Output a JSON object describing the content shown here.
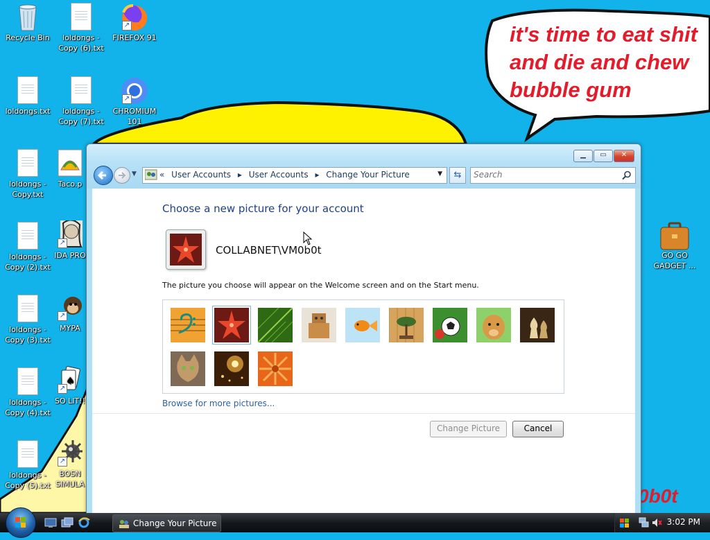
{
  "desktop": {
    "icons": [
      {
        "label": "Recycle Bin",
        "kind": "recycle-bin"
      },
      {
        "label": "loldongs - Copy (6).txt",
        "kind": "text-file"
      },
      {
        "label": "FIREFOX 91",
        "kind": "firefox"
      },
      {
        "label": "loldongs.txt",
        "kind": "text-file"
      },
      {
        "label": "loldongs - Copy (7).txt",
        "kind": "text-file"
      },
      {
        "label": "CHROMIUM 101",
        "kind": "chromium"
      },
      {
        "label": "loldongs - Copy.txt",
        "kind": "text-file"
      },
      {
        "label": "Taco.p",
        "kind": "image-file"
      },
      {
        "label": "loldongs - Copy (2).txt",
        "kind": "text-file"
      },
      {
        "label": "IDA PRO",
        "kind": "ida"
      },
      {
        "label": "loldongs - Copy (3).txt",
        "kind": "text-file"
      },
      {
        "label": "MYPA",
        "kind": "monkey"
      },
      {
        "label": "loldongs - Copy (4).txt",
        "kind": "text-file"
      },
      {
        "label": "SO LIT!!",
        "kind": "cards"
      },
      {
        "label": "loldongs - Copy (5).txt",
        "kind": "text-file"
      },
      {
        "label": "BOSN SIMULA",
        "kind": "mine"
      },
      {
        "label": "GO GO GADGET ...",
        "kind": "briefcase"
      }
    ],
    "bubble_text": "it's time to eat shit\nand die and chew\nbubble gum",
    "watermark": "0b0t"
  },
  "window": {
    "breadcrumbs": [
      "User Accounts",
      "User Accounts",
      "Change Your Picture"
    ],
    "breadcrumb_prefix": "«",
    "search_placeholder": "Search",
    "heading": "Choose a new picture for your account",
    "username": "COLLABNET\\VM0b0t",
    "description": "The picture you choose will appear on the Welcome screen and on the Start menu.",
    "pictures": [
      "bass clef",
      "starfish",
      "leaf",
      "robot",
      "goldfish",
      "bonsai",
      "soccer ball",
      "dog",
      "chess",
      "kitten",
      "sparkles",
      "orange flower"
    ],
    "selected_picture": "starfish",
    "browse_link": "Browse for more pictures...",
    "buttons": {
      "change": "Change Picture",
      "cancel": "Cancel"
    },
    "controls": {
      "minimize": "minimize",
      "maximize": "maximize",
      "close": "close"
    }
  },
  "taskbar": {
    "task_label": "Change Your Picture",
    "clock": "3:02 PM"
  }
}
